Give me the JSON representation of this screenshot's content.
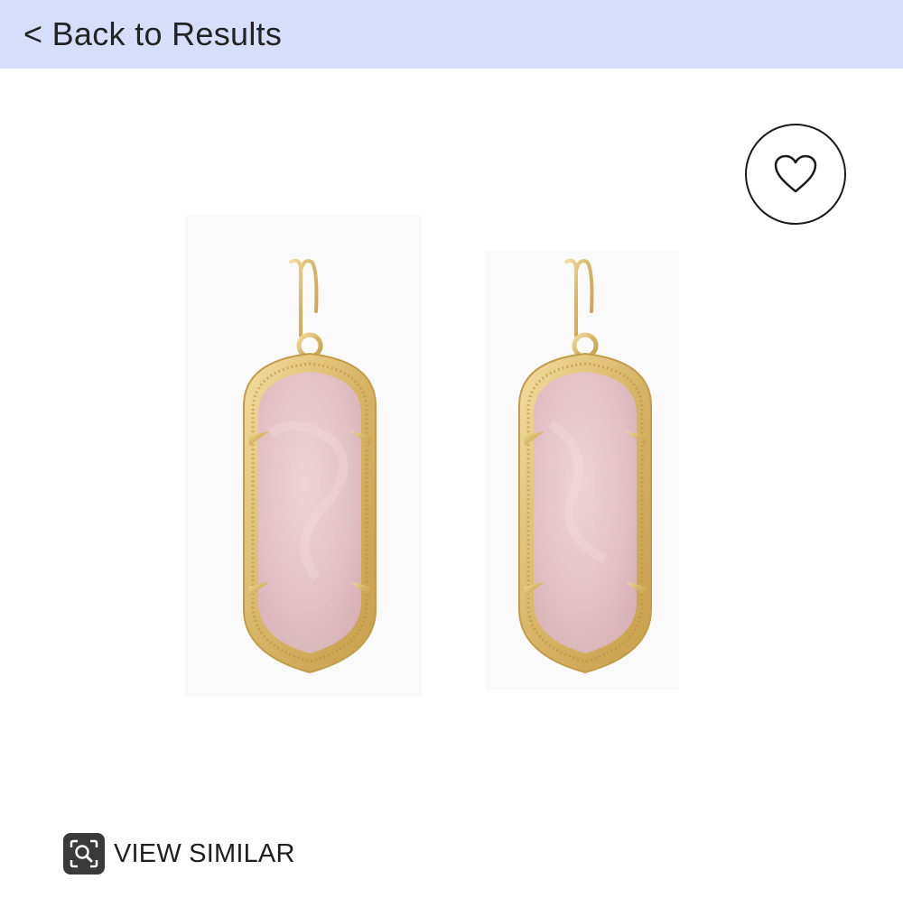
{
  "header": {
    "back_label": "< Back to Results",
    "background": "#d6defa"
  },
  "product": {
    "image_alt": "Pair of gold drop earrings with rose quartz oval stones",
    "stone_color": "#e4c5c9",
    "metal_color": "#d9b96a"
  },
  "favorite": {
    "icon": "heart-outline-icon"
  },
  "actions": {
    "view_similar_label": "VIEW SIMILAR",
    "view_similar_icon": "visual-search-icon"
  }
}
